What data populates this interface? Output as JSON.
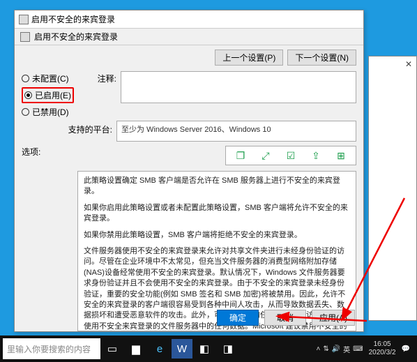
{
  "window": {
    "title": "启用不安全的来宾登录",
    "section_title": "启用不安全的来宾登录"
  },
  "nav": {
    "prev": "上一个设置(P)",
    "next": "下一个设置(N)"
  },
  "radios": {
    "not_configured": "未配置(C)",
    "enabled": "已启用(E)",
    "disabled": "已禁用(D)"
  },
  "labels": {
    "comment": "注释:",
    "platform": "支持的平台:",
    "options": "选项:"
  },
  "platform_text": "至少为 Windows Server 2016、Windows 10",
  "help": {
    "p1": "此策略设置确定 SMB 客户端是否允许在 SMB 服务器上进行不安全的来宾登录。",
    "p2": "如果你启用此策略设置或者未配置此策略设置，SMB 客户端将允许不安全的来宾登录。",
    "p3": "如果你禁用此策略设置，SMB 客户端将拒绝不安全的来宾登录。",
    "p4": "文件服务器使用不安全的来宾登录来允许对共享文件夹进行未经身份验证的访问。尽管在企业环境中不太常见，但充当文件服务器的消费型网络附加存储(NAS)设备经常使用不安全的来宾登录。默认情况下，Windows 文件服务器要求身份验证并且不会使用不安全的来宾登录。由于不安全的来宾登录未经身份验证，重要的安全功能(例如 SMB 签名和 SMB 加密)将被禁用。因此，允许不安全的来宾登录的客户端很容易受到各种中间人攻击，从而导致数据丢失、数据损坏和遭受恶意软件的攻击。此外，可能网络上的任何人都可以访问写入到使用不安全来宾登录的文件服务器中的任何数据。Microsoft 建议禁用不安全的来宾登录，并将文件服务器配置为要求经过身份验证的访问。"
  },
  "buttons": {
    "ok": "确定",
    "cancel": "取消",
    "apply": "应用(A)"
  },
  "taskbar": {
    "search_placeholder": "里输入你要搜索的内容"
  },
  "systray": {
    "ime": "英",
    "time": "16:05",
    "date": "2020/3/2"
  }
}
